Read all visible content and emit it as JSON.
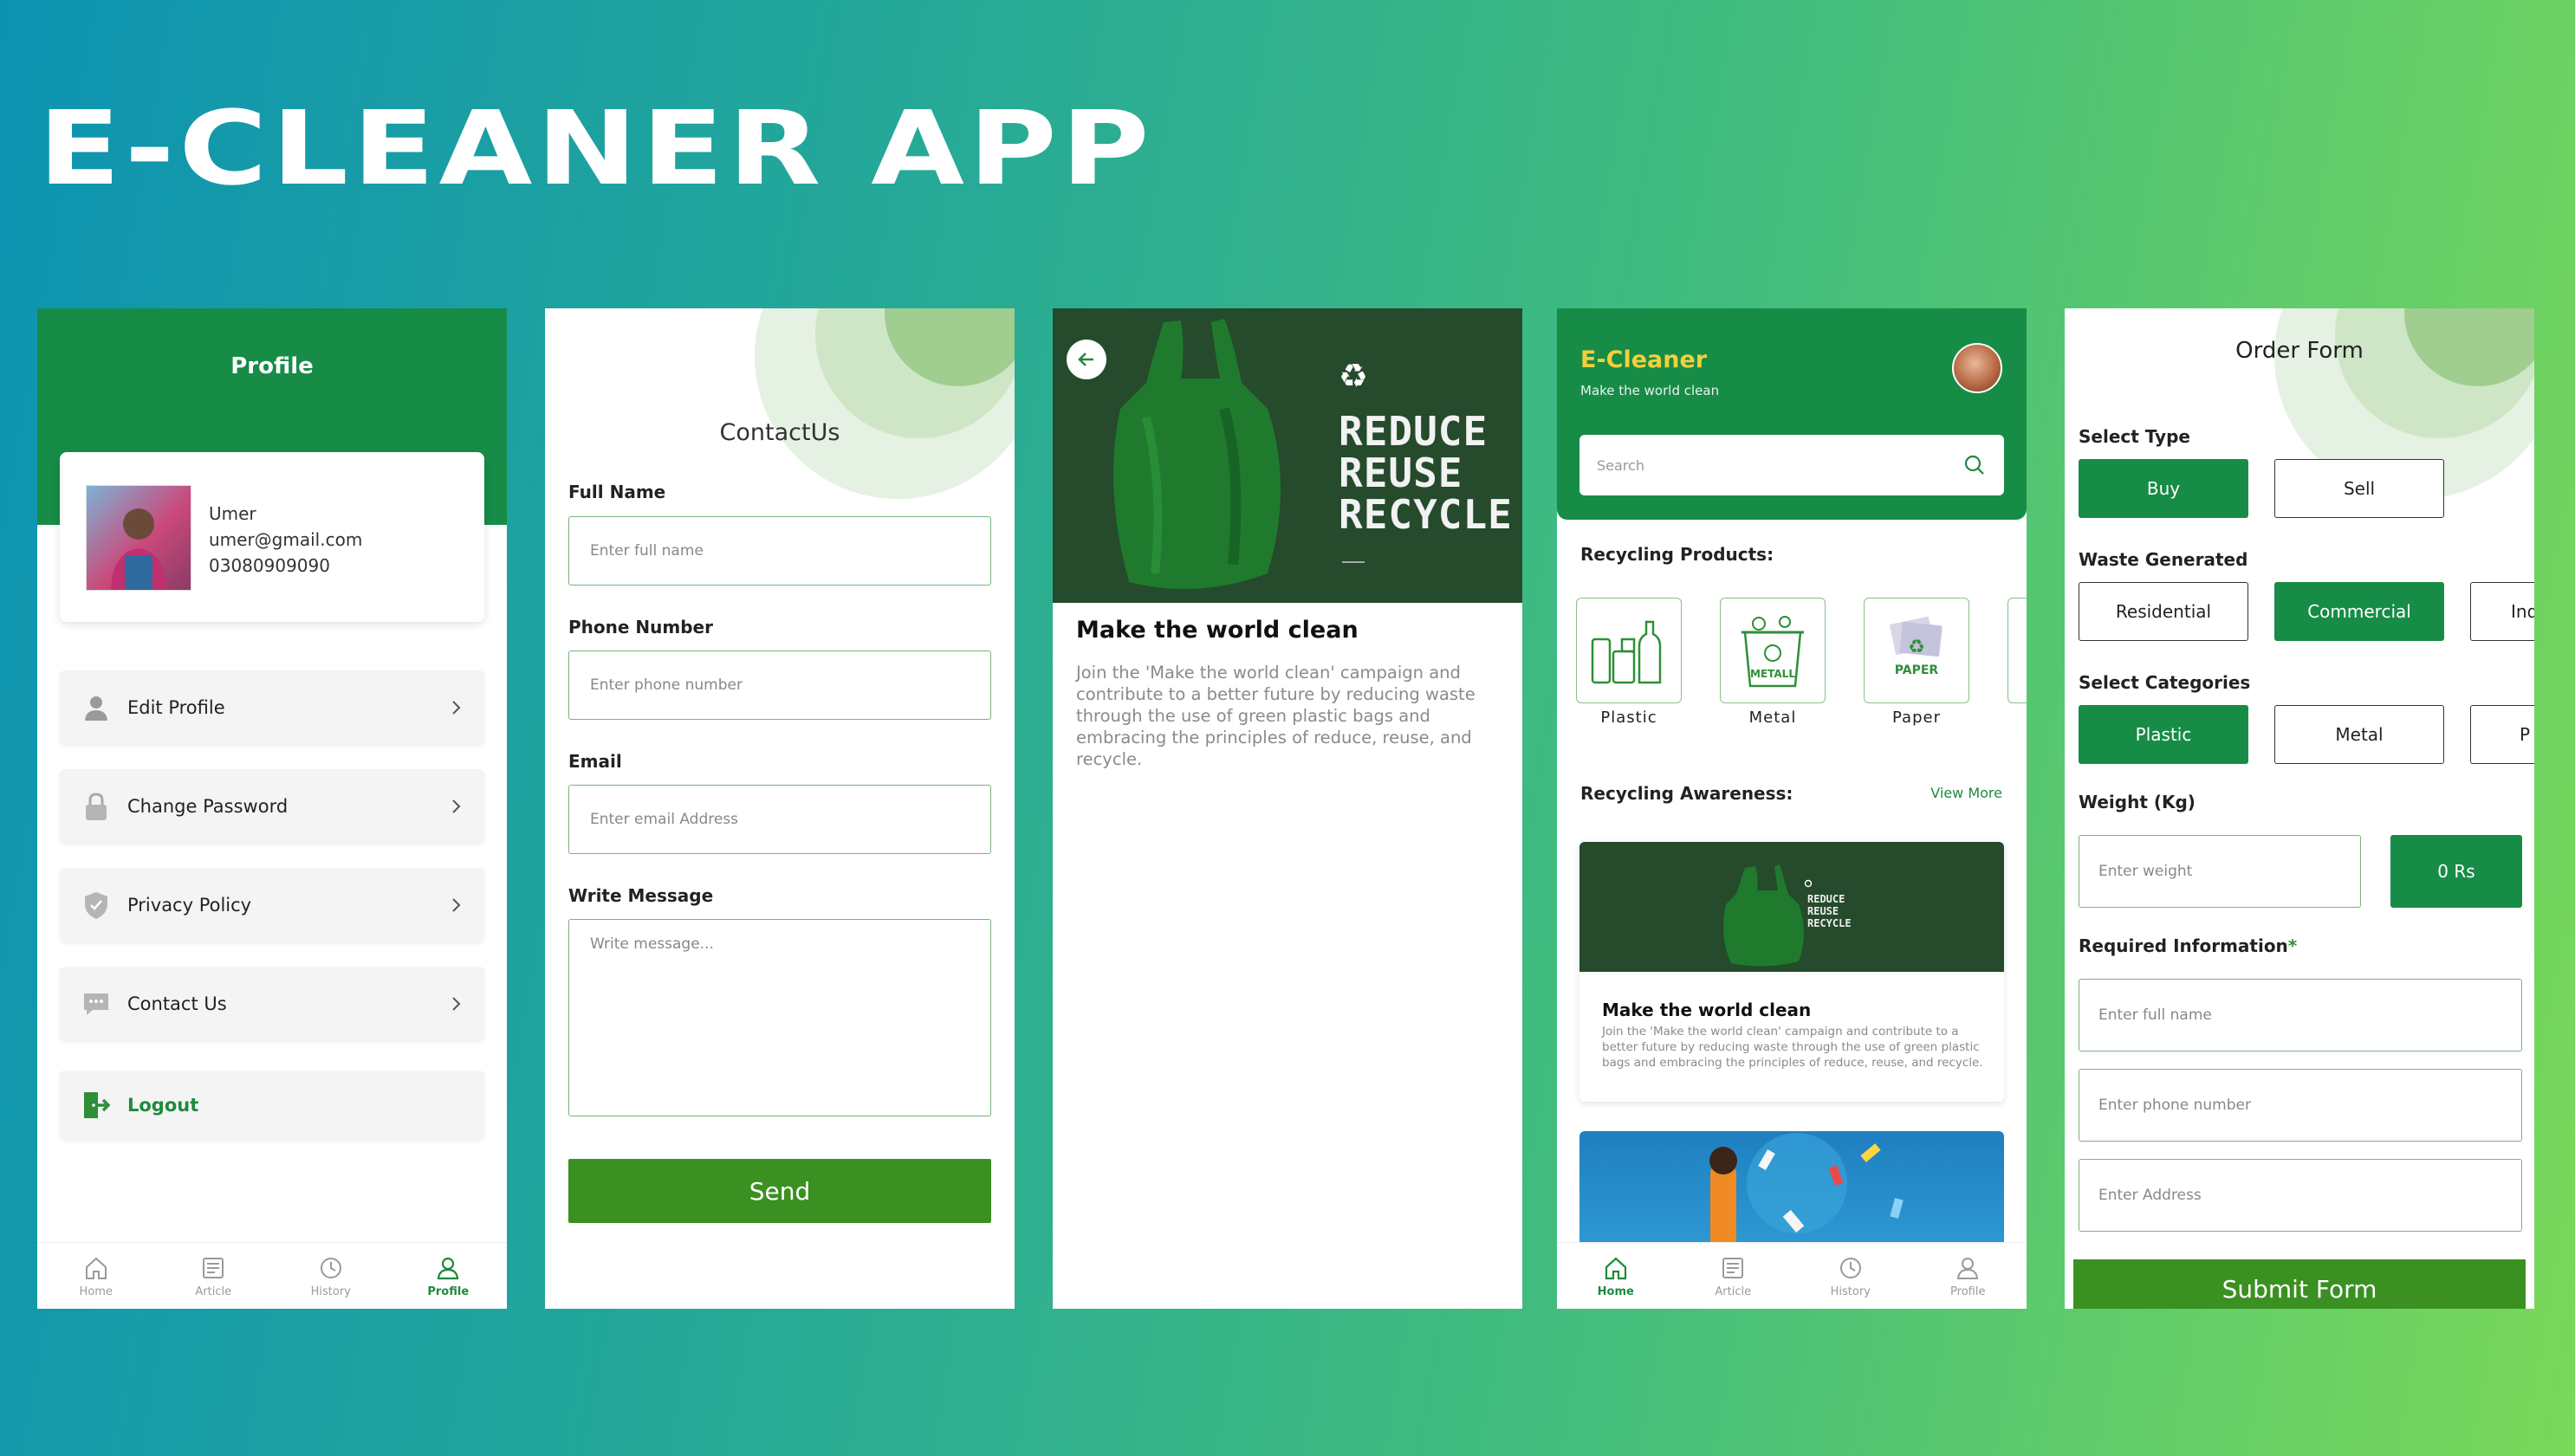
{
  "hero_title": "E-CLEANER APP",
  "colors": {
    "brand_green": "#178c47",
    "button_green": "#3a9021",
    "dark_green": "#254a2c"
  },
  "nav": {
    "home": "Home",
    "article": "Article",
    "history": "History",
    "profile": "Profile"
  },
  "profile_screen": {
    "title": "Profile",
    "user": {
      "name": "Umer",
      "email": "umer@gmail.com",
      "phone": "03080909090"
    },
    "menu": [
      {
        "label": "Edit Profile",
        "icon": "user-icon"
      },
      {
        "label": "Change Password",
        "icon": "lock-icon"
      },
      {
        "label": "Privacy Policy",
        "icon": "shield-icon"
      },
      {
        "label": "Contact Us",
        "icon": "chat-icon"
      }
    ],
    "logout": "Logout",
    "active_tab": "Profile"
  },
  "contact_screen": {
    "title": "ContactUs",
    "full_name_label": "Full Name",
    "full_name_placeholder": "Enter full name",
    "phone_label": "Phone Number",
    "phone_placeholder": "Enter phone number",
    "email_label": "Email",
    "email_placeholder": "Enter email Address",
    "message_label": "Write Message",
    "message_placeholder": "Write message...",
    "send": "Send"
  },
  "article_screen": {
    "hero_lines": [
      "REDUCE",
      "REUSE",
      "RECYCLE"
    ],
    "title": "Make the world clean",
    "body": "Join the 'Make the world clean' campaign and contribute to a better future by reducing waste through the use of green plastic bags and embracing the principles of reduce, reuse, and recycle."
  },
  "home_screen": {
    "brand": "E-Cleaner",
    "tagline": "Make the world clean",
    "search_placeholder": "Search",
    "products_title": "Recycling Products:",
    "products": [
      {
        "label": "Plastic",
        "icon": "plastic-bottles-icon"
      },
      {
        "label": "Metal",
        "icon": "metal-bin-icon",
        "badge": "METALL"
      },
      {
        "label": "Paper",
        "icon": "paper-icon",
        "badge": "PAPER"
      }
    ],
    "awareness_title": "Recycling Awareness:",
    "view_more": "View More",
    "card": {
      "hero_lines": [
        "REDUCE",
        "REUSE",
        "RECYCLE"
      ],
      "title": "Make the world clean",
      "body": "Join the 'Make the world clean' campaign and contribute to a better future by reducing waste through the use of green plastic bags and embracing the principles of reduce, reuse, and recycle."
    },
    "active_tab": "Home"
  },
  "order_screen": {
    "title": "Order Form",
    "select_type_label": "Select Type",
    "types": [
      "Buy",
      "Sell"
    ],
    "selected_type": "Buy",
    "waste_label": "Waste Generated",
    "waste_options": [
      "Residential",
      "Commercial",
      "Ind"
    ],
    "selected_waste": "Commercial",
    "categories_label": "Select Categories",
    "categories": [
      "Plastic",
      "Metal",
      "P"
    ],
    "selected_category": "Plastic",
    "weight_label": "Weight (Kg)",
    "weight_placeholder": "Enter weight",
    "price": "0 Rs",
    "required_label": "Required Information",
    "required_mark": "*",
    "name_placeholder": "Enter full name",
    "phone_placeholder": "Enter phone number",
    "address_placeholder": "Enter Address",
    "submit": "Submit Form"
  }
}
